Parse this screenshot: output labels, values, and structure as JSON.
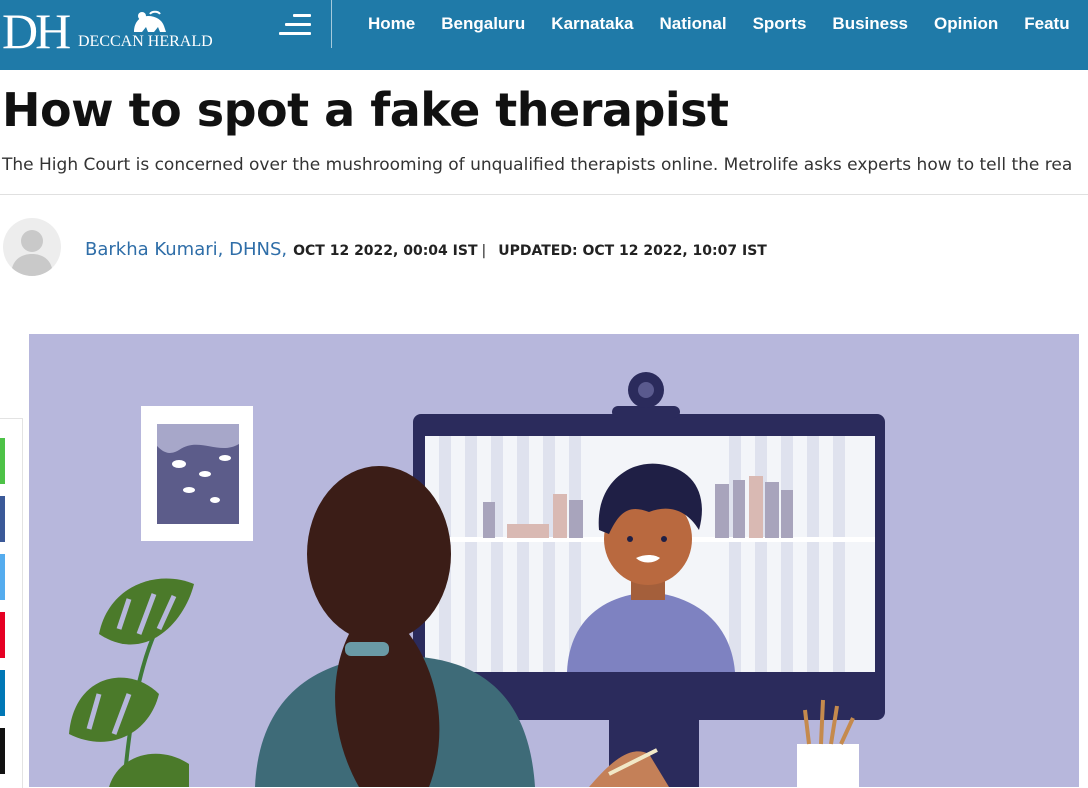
{
  "header": {
    "logo_letters": "DH",
    "logo_name": "DECCAN HERALD",
    "menu_icon": "hamburger-menu-icon",
    "background_color": "#1f7aa8",
    "nav_items": [
      "Home",
      "Bengaluru",
      "Karnataka",
      "National",
      "Sports",
      "Business",
      "Opinion",
      "Featu"
    ]
  },
  "article": {
    "title": "How to spot a fake therapist",
    "standfirst": "The High Court is concerned over the mushrooming of unqualified therapists online. Metrolife asks experts how to tell the rea",
    "author": "Barkha Kumari, DHNS,",
    "published": "OCT 12 2022, 00:04 IST",
    "separator": "|",
    "updated": "UPDATED: OCT 12 2022, 10:07 IST",
    "author_link_color": "#2f6ea8"
  },
  "share_bar": {
    "buttons": [
      {
        "name": "whatsapp",
        "color": "#4dc247"
      },
      {
        "name": "facebook",
        "color": "#3b5998"
      },
      {
        "name": "twitter",
        "color": "#55acee"
      },
      {
        "name": "pinterest",
        "color": "#e60023"
      },
      {
        "name": "linkedin",
        "color": "#0077b5"
      },
      {
        "name": "email",
        "color": "#111111"
      }
    ]
  }
}
